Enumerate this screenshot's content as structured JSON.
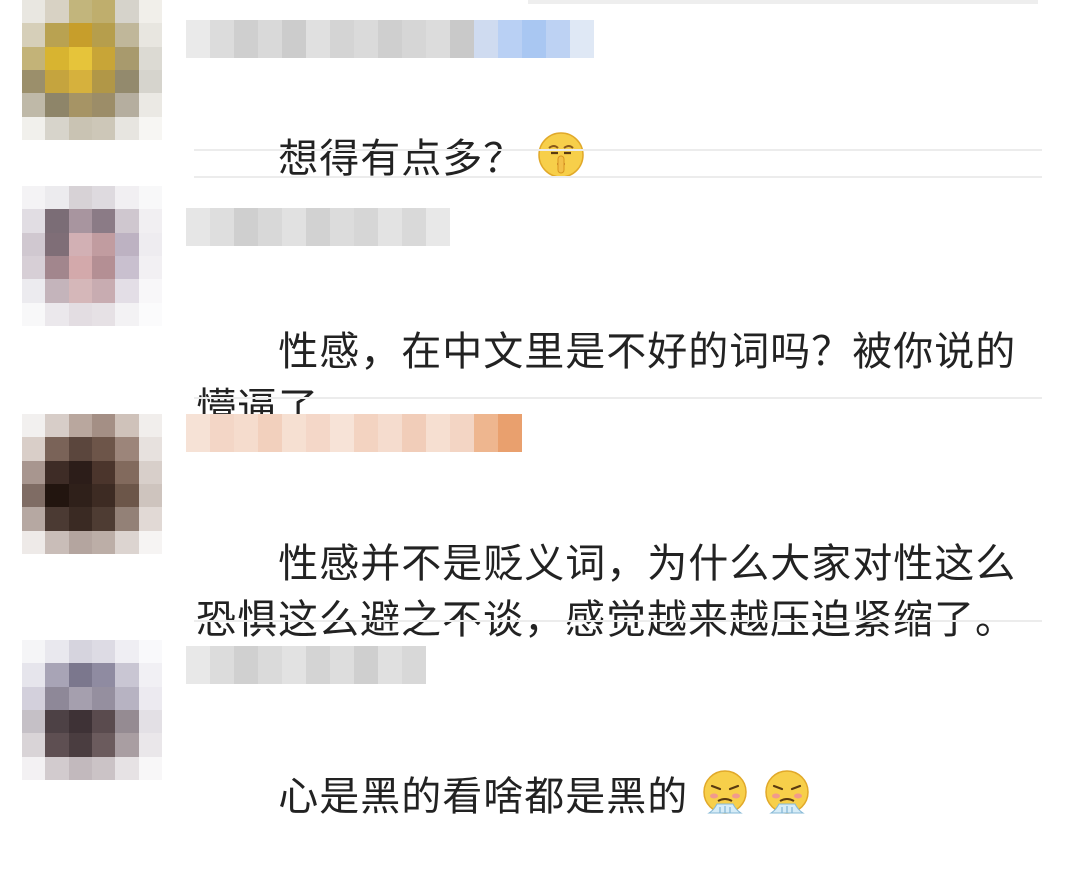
{
  "comments": [
    {
      "text": "想得有点多？",
      "emojis": [
        "shushing-face-icon"
      ],
      "avatar_palette": [
        "#e9e7e1",
        "#d8d2c4",
        "#c2b57c",
        "#bfae6d",
        "#d6d3cb",
        "#f1efea",
        "#d6cfb9",
        "#b9a251",
        "#c79e2b",
        "#b69e4c",
        "#c0b79a",
        "#e8e6e0",
        "#c3b378",
        "#d8b430",
        "#e6c43a",
        "#c8a537",
        "#a89a6d",
        "#dcdad3",
        "#9b8f6b",
        "#c5a43e",
        "#d6b13d",
        "#b19747",
        "#938a6d",
        "#d6d4cd",
        "#bfb9a8",
        "#8e8569",
        "#a69465",
        "#9c8d68",
        "#b5ae9f",
        "#ebe9e4",
        "#f1f0ec",
        "#d7d4cb",
        "#c9c3b3",
        "#cdc7b8",
        "#e7e5e0",
        "#f7f6f3"
      ],
      "name_palette": [
        "#eaeaea",
        "#dcdcdc",
        "#cfcfcf",
        "#d9d9d9",
        "#cccccc",
        "#e0e0e0",
        "#d4d4d4",
        "#dadada",
        "#cfcfcf",
        "#d6d6d6",
        "#dcdcdc",
        "#c9c9c9",
        "#cfdbf0",
        "#b9d0f4",
        "#a9c7f2",
        "#bdd2f3",
        "#dfe8f5"
      ]
    },
    {
      "text": "性感，在中文里是不好的词吗？被你说的懵逼了",
      "emojis": [],
      "avatar_palette": [
        "#f4f3f5",
        "#ecebee",
        "#d7d2d6",
        "#dedadf",
        "#f1eff2",
        "#f8f8f9",
        "#e1dde3",
        "#7b6d76",
        "#a8959f",
        "#8b7b86",
        "#cfc7cf",
        "#f1eff2",
        "#d0c8d0",
        "#7f6e77",
        "#d2b0b4",
        "#c19ca0",
        "#bdb2c2",
        "#eeecf0",
        "#d7cfd6",
        "#a2868d",
        "#d3a9ab",
        "#b48f94",
        "#c9c0cf",
        "#f2f0f3",
        "#ecebef",
        "#c4b4bb",
        "#d5b7b9",
        "#c8acb1",
        "#e3dee6",
        "#f8f7f9",
        "#f8f8f9",
        "#ebe8ec",
        "#e3dde2",
        "#e6e1e5",
        "#f3f2f4",
        "#fbfbfc"
      ],
      "name_palette": [
        "#e6e6e6",
        "#dedede",
        "#cfcfcf",
        "#d8d8d8",
        "#e1e1e1",
        "#d2d2d2",
        "#dcdcdc",
        "#d6d6d6",
        "#e3e3e3",
        "#d9d9d9",
        "#e8e8e8"
      ]
    },
    {
      "text": "性感并不是贬义词，为什么大家对性这么恐惧这么避之不谈，感觉越来越压迫紧缩了。",
      "emojis": [],
      "avatar_palette": [
        "#f2f0ef",
        "#d7cdc8",
        "#b9a79e",
        "#a48f85",
        "#cfc2ba",
        "#f1eeec",
        "#d9cec8",
        "#7a6358",
        "#5b463d",
        "#6d5549",
        "#9c857a",
        "#e7e1de",
        "#a8968f",
        "#3e2c26",
        "#2c1d19",
        "#4b352c",
        "#826a5d",
        "#d8cfca",
        "#7f6c64",
        "#22150f",
        "#2f201a",
        "#3d2b23",
        "#6c5649",
        "#cec4be",
        "#b6a8a2",
        "#4b3a33",
        "#3a2a23",
        "#4e3c33",
        "#938177",
        "#e1d9d5",
        "#eeeae8",
        "#c9bdb8",
        "#b4a59f",
        "#bcaea7",
        "#dcd4d0",
        "#f6f4f3"
      ],
      "name_palette": [
        "#f6e2d6",
        "#f3d6c6",
        "#f5dccd",
        "#f2d0bd",
        "#f6e0d2",
        "#f4d7c8",
        "#f7e3d7",
        "#f3d3c1",
        "#f5dcce",
        "#f1cdb9",
        "#f6dfd1",
        "#f3d5c4",
        "#eeb68f",
        "#e9a06e"
      ]
    },
    {
      "text": "心是黑的看啥都是黑的",
      "emojis": [
        "steam-face-icon",
        "steam-face-icon"
      ],
      "avatar_palette": [
        "#f5f5f7",
        "#e9e8ee",
        "#d6d4de",
        "#dddbe4",
        "#efeef3",
        "#f9f9fb",
        "#e6e5ec",
        "#a8a4b6",
        "#7b778d",
        "#8f8ba1",
        "#c9c6d3",
        "#f1f0f4",
        "#d3d0dc",
        "#8e8898",
        "#a59fae",
        "#958f9f",
        "#b7b3c2",
        "#eceaf0",
        "#c5c0c6",
        "#4d4145",
        "#3e3236",
        "#5a4b4e",
        "#958b92",
        "#e3e0e5",
        "#d9d4d7",
        "#5e4f52",
        "#4a3d40",
        "#6b5b5d",
        "#a99ea2",
        "#eae7ea",
        "#f3f1f3",
        "#d2cbce",
        "#c2b9bd",
        "#cbc3c6",
        "#e6e2e4",
        "#f8f7f8"
      ],
      "name_palette": [
        "#e8e8e8",
        "#dcdcdc",
        "#d0d0d0",
        "#dadada",
        "#e2e2e2",
        "#d4d4d4",
        "#dddddd",
        "#cfcfcf",
        "#e0e0e0",
        "#d8d8d8"
      ]
    }
  ]
}
